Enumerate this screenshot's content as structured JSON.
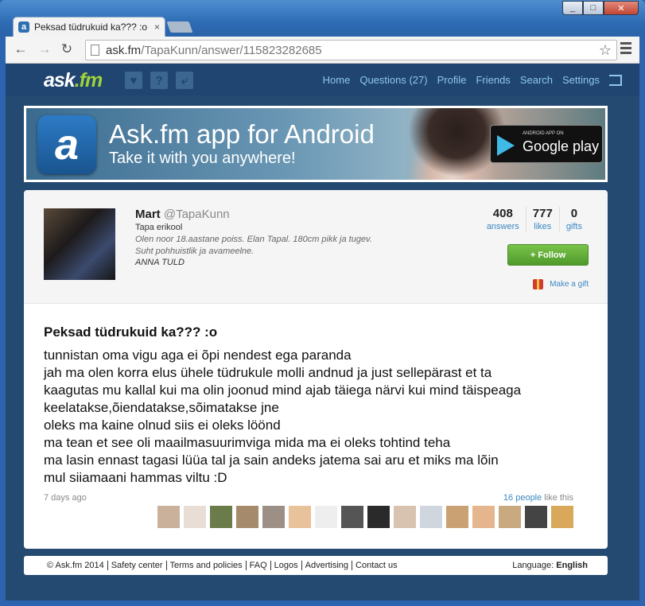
{
  "browser": {
    "tab_title": "Peksad tüdrukuid ka??? :o",
    "tab_close": "×",
    "url_host": "ask.fm",
    "url_path": "/TapaKunn/answer/115823282685"
  },
  "header": {
    "logo": "ask.fm",
    "nav": [
      "Home",
      "Questions (27)",
      "Profile",
      "Friends",
      "Search",
      "Settings"
    ]
  },
  "banner": {
    "title": "Ask.fm app for Android",
    "subtitle": "Take it with you anywhere!",
    "badge_small": "ANDROID APP ON",
    "badge_big": "Google play"
  },
  "profile": {
    "name": "Mart",
    "username": "@TapaKunn",
    "school": "Tapa erikool",
    "bio": "Olen noor 18.aastane poiss. Elan Tapal. 180cm pikk ja tugev. Suht pohhuistlik ja avameelne.",
    "motto": "ANNA TULD",
    "stats": [
      {
        "num": "408",
        "label": "answers"
      },
      {
        "num": "777",
        "label": "likes"
      },
      {
        "num": "0",
        "label": "gifts"
      }
    ],
    "follow_label": "+ Follow",
    "gift_label": "Make a gift"
  },
  "answer": {
    "question": "Peksad tüdrukuid ka??? :o",
    "lines": [
      "tunnistan oma vigu aga ei õpi nendest ega paranda",
      "jah ma olen korra elus ühele tüdrukule molli andnud ja just sellepärast et ta",
      "kaagutas mu kallal kui ma olin joonud mind ajab täiega närvi kui mind täispeaga",
      "keelatakse,õiendatakse,sõimatakse jne",
      "oleks ma kaine olnud siis ei oleks löönd",
      "ma tean et see oli maailmasuurimviga mida ma ei oleks tohtind teha",
      "ma lasin ennast tagasi lüüa tal ja sain andeks jatema sai aru et miks ma lõin",
      "mul siiamaani hammas viltu :D"
    ],
    "time": "7 days ago",
    "likes_link": "16 people",
    "likes_suffix": " like this",
    "liker_colors": [
      "#c9b19c",
      "#e8ded5",
      "#6b7b4a",
      "#a58b6b",
      "#9c8f86",
      "#e8c29a",
      "#eee",
      "#555",
      "#2a2a2a",
      "#d8c3b0",
      "#cfd6de",
      "#caa173",
      "#e5b58e",
      "#c8a980",
      "#444",
      "#d9a85a"
    ]
  },
  "footer": {
    "links": [
      "© Ask.fm 2014",
      "Safety center",
      "Terms and policies",
      "FAQ",
      "Logos",
      "Advertising",
      "Contact us"
    ],
    "language_label": "Language:",
    "language_value": "English"
  }
}
